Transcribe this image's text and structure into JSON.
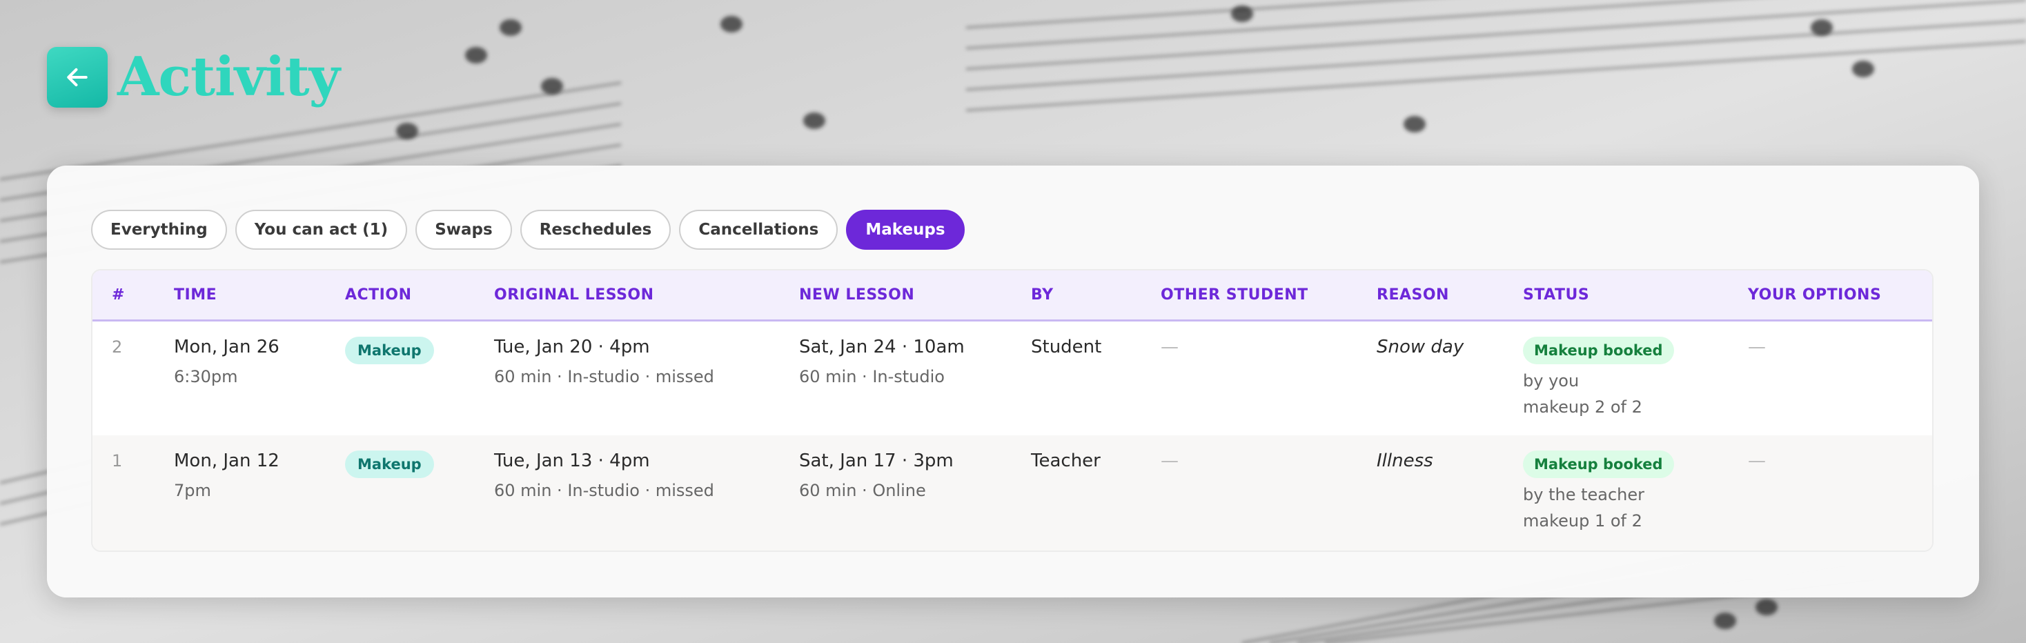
{
  "header": {
    "back_icon": "arrow-left-icon",
    "title": "Activity"
  },
  "filters": [
    {
      "label": "Everything",
      "active": false
    },
    {
      "label": "You can act (1)",
      "active": false
    },
    {
      "label": "Swaps",
      "active": false
    },
    {
      "label": "Reschedules",
      "active": false
    },
    {
      "label": "Cancellations",
      "active": false
    },
    {
      "label": "Makeups",
      "active": true
    }
  ],
  "table": {
    "columns": [
      "#",
      "TIME",
      "ACTION",
      "ORIGINAL LESSON",
      "NEW LESSON",
      "BY",
      "OTHER STUDENT",
      "REASON",
      "STATUS",
      "YOUR OPTIONS"
    ],
    "rows": [
      {
        "num": "2",
        "time_date": "Mon, Jan 26",
        "time_clock": "6:30pm",
        "action": "Makeup",
        "orig_main": "Tue, Jan 20 · 4pm",
        "orig_sub": "60 min · In-studio · missed",
        "new_main": "Sat, Jan 24 · 10am",
        "new_sub": "60 min · In-studio",
        "by": "Student",
        "other_student": "—",
        "reason": "Snow day",
        "status": "Makeup booked",
        "status_by": "by you",
        "status_count": "makeup 2 of 2",
        "options": "—"
      },
      {
        "num": "1",
        "time_date": "Mon, Jan 12",
        "time_clock": "7pm",
        "action": "Makeup",
        "orig_main": "Tue, Jan 13 · 4pm",
        "orig_sub": "60 min · In-studio · missed",
        "new_main": "Sat, Jan 17 · 3pm",
        "new_sub": "60 min · Online",
        "by": "Teacher",
        "other_student": "—",
        "reason": "Illness",
        "status": "Makeup booked",
        "status_by": "by the teacher",
        "status_count": "makeup 1 of 2",
        "options": "—"
      }
    ]
  },
  "colors": {
    "accent_purple": "#6d28d9",
    "teal": "#2fd6bd",
    "status_green": "#15803d"
  }
}
